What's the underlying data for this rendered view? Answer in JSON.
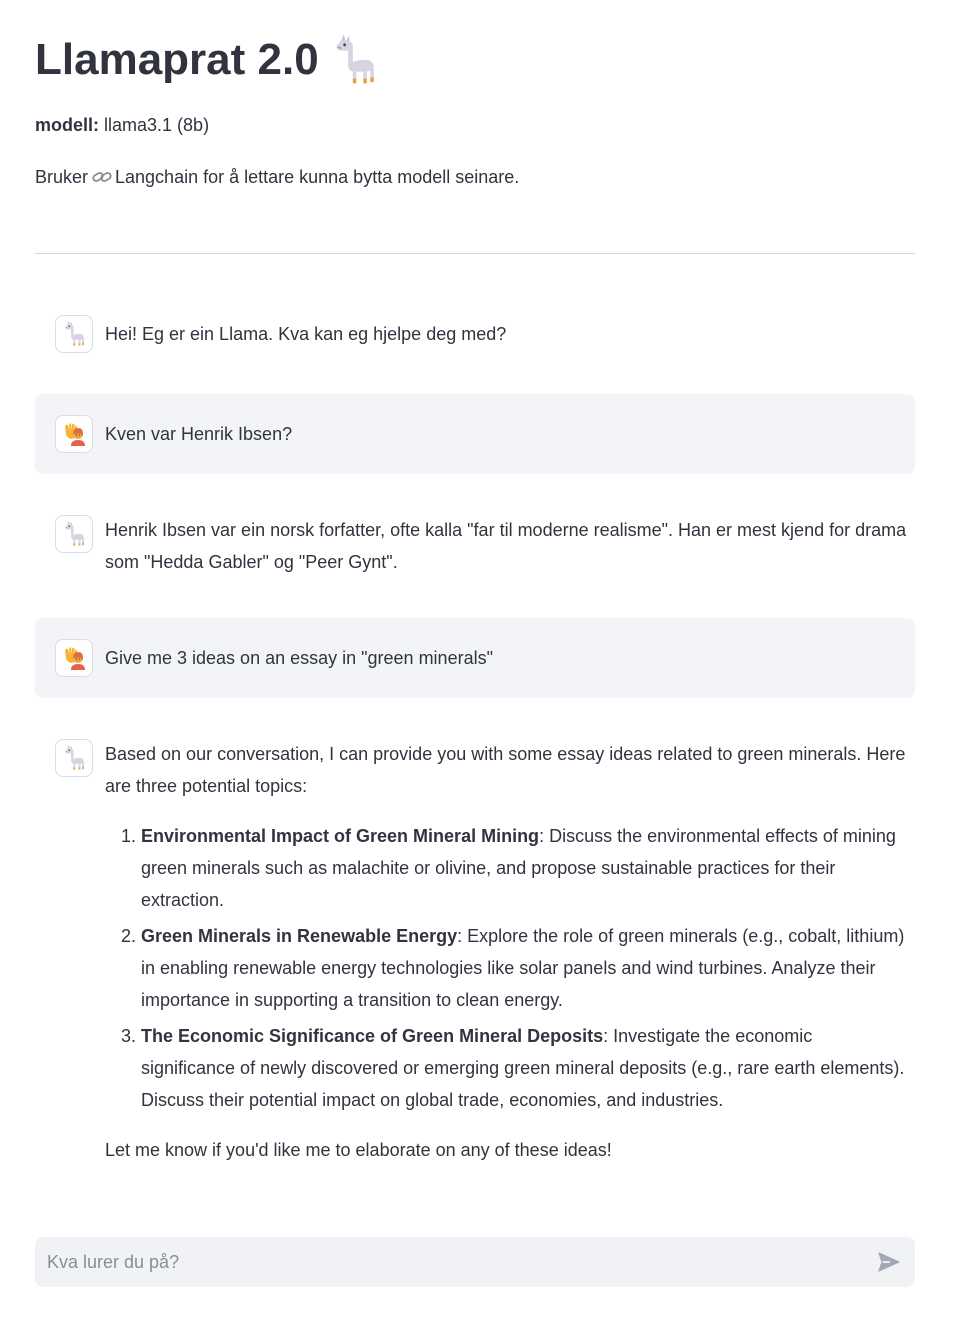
{
  "header": {
    "title": "Llamaprat 2.0",
    "title_icon": "llama-icon",
    "model_label": "modell:",
    "model_value": " llama3.1 (8b)",
    "desc_before": "Bruker",
    "desc_icon": "link-icon",
    "desc_after": "Langchain for å lettare kunna bytta modell seinare."
  },
  "messages": [
    {
      "role": "assistant",
      "avatar": "llama-icon",
      "text": "Hei! Eg er ein Llama. Kva kan eg hjelpe deg med?"
    },
    {
      "role": "user",
      "avatar": "raising-hand-icon",
      "text": "Kven var Henrik Ibsen?"
    },
    {
      "role": "assistant",
      "avatar": "llama-icon",
      "text": "Henrik Ibsen var ein norsk forfatter, ofte kalla \"far til moderne realisme\". Han er mest kjend for drama som \"Hedda Gabler\" og \"Peer Gynt\"."
    },
    {
      "role": "user",
      "avatar": "raising-hand-icon",
      "text": "Give me 3 ideas on an essay in \"green minerals\""
    },
    {
      "role": "assistant",
      "avatar": "llama-icon",
      "intro": "Based on our conversation, I can provide you with some essay ideas related to green minerals. Here are three potential topics:",
      "ideas": [
        {
          "title": "Environmental Impact of Green Mineral Mining",
          "text": ": Discuss the environmental effects of mining green minerals such as malachite or olivine, and propose sustainable practices for their extraction."
        },
        {
          "title": "Green Minerals in Renewable Energy",
          "text": ": Explore the role of green minerals (e.g., cobalt, lithium) in enabling renewable energy technologies like solar panels and wind turbines. Analyze their importance in supporting a transition to clean energy."
        },
        {
          "title": "The Economic Significance of Green Mineral Deposits",
          "text": ": Investigate the economic significance of newly discovered or emerging green mineral deposits (e.g., rare earth elements). Discuss their potential impact on global trade, economies, and industries."
        }
      ],
      "outro": "Let me know if you'd like me to elaborate on any of these ideas!"
    }
  ],
  "chat_input": {
    "placeholder": "Kva lurer du på?",
    "value": "",
    "send_icon": "send-icon"
  },
  "colors": {
    "text": "#31333f",
    "user_bubble": "#f3f4f7",
    "input_bg": "#f0f2f6",
    "send_icon": "#a3a8b4"
  }
}
